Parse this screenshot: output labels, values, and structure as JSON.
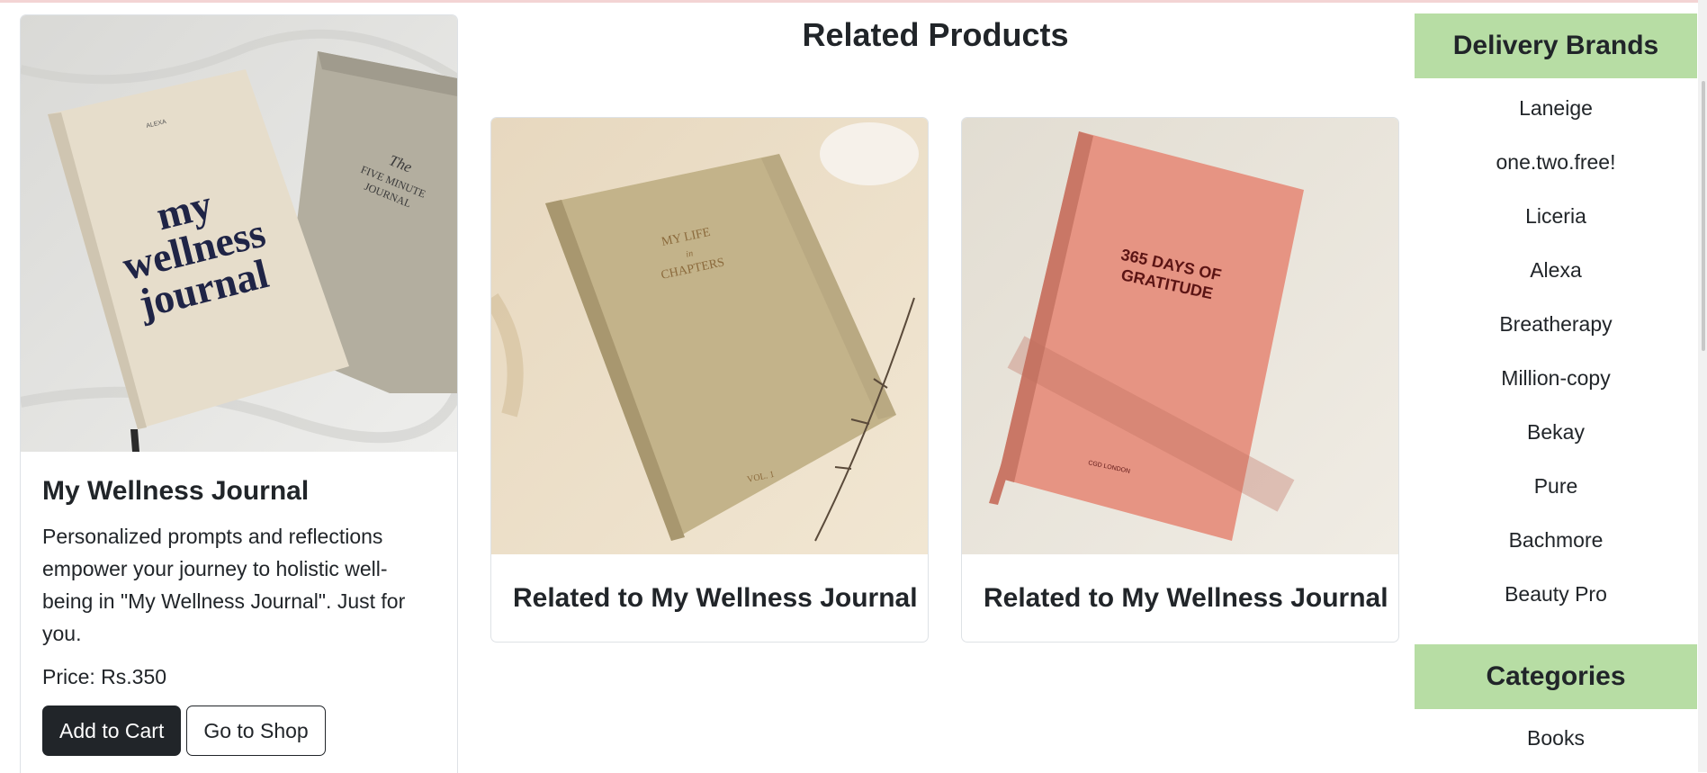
{
  "product": {
    "title": "My Wellness Journal",
    "description": "Personalized prompts and reflections empower your journey to holistic well-being in \"My Wellness Journal\". Just for you.",
    "price": "Price: Rs.350",
    "add_to_cart_label": "Add to Cart",
    "go_to_shop_label": "Go to Shop",
    "cover_text": "my wellness journal",
    "cover_small": "ALEXA",
    "second_book_text": "The FIVE MINUTE JOURNAL"
  },
  "related": {
    "heading": "Related Products",
    "items": [
      {
        "title": "Related to My Wellness Journal",
        "cover_text": "MY LIFE in CHAPTERS",
        "cover_footer": "VOL. 1"
      },
      {
        "title": "Related to My Wellness Journal",
        "cover_text": "365 DAYS OF GRATITUDE",
        "cover_footer": "CGD LONDON"
      }
    ]
  },
  "sidebar": {
    "brands_heading": "Delivery Brands",
    "brands": [
      "Laneige",
      "one.two.free!",
      "Liceria",
      "Alexa",
      "Breatherapy",
      "Million-copy",
      "Bekay",
      "Pure",
      "Bachmore",
      "Beauty Pro"
    ],
    "categories_heading": "Categories",
    "categories": [
      "Books"
    ]
  },
  "colors": {
    "sidebar_header": "#b7dda4",
    "dark_button": "#212529"
  }
}
